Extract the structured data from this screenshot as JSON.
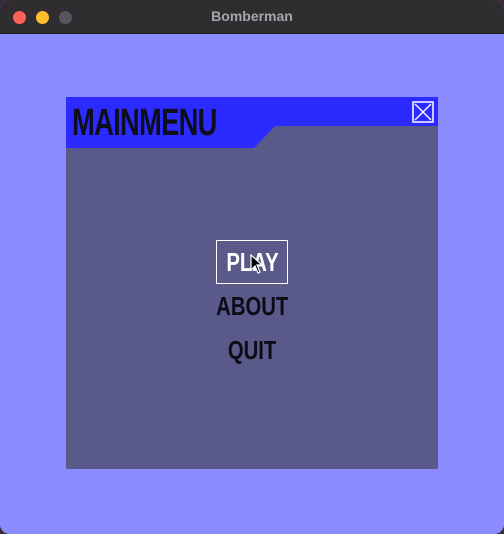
{
  "window": {
    "title": "Bomberman"
  },
  "panel": {
    "title": "MAINMENU",
    "close_icon": "close-x-icon"
  },
  "menu": {
    "items": [
      {
        "label": "PLAY",
        "selected": true
      },
      {
        "label": "ABOUT",
        "selected": false
      },
      {
        "label": "QUIT",
        "selected": false
      }
    ]
  },
  "colors": {
    "background": "#8b8bfd",
    "panel": "#5a5a8a",
    "header": "#2b2bff",
    "selected_text": "#ffffff",
    "text": "#0c0c16"
  }
}
